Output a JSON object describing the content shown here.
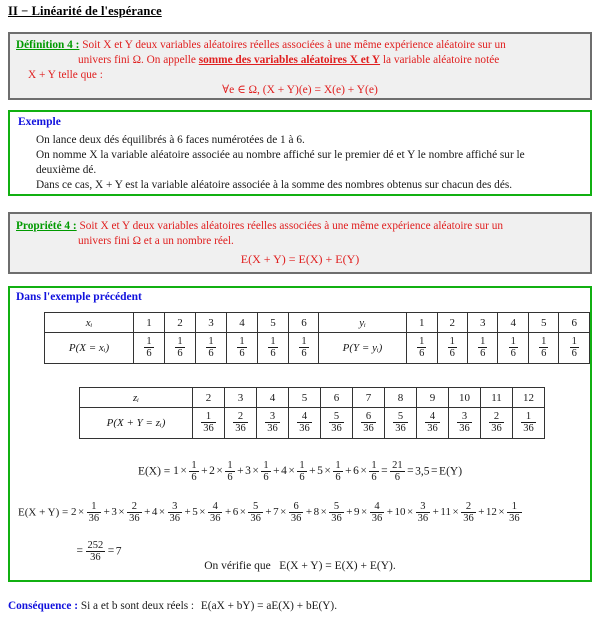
{
  "document": {
    "section_title": "II − Linéarité de l'espérance"
  },
  "definition_box": {
    "label": "Définition 4 :",
    "line1": "Soit X et Y deux variables aléatoires réelles associées à une même expérience aléatoire sur un",
    "line2_before": "univers fini Ω. On appelle ",
    "line2_emph": "somme des variables aléatoires X et Y",
    "line2_after": " la variable aléatoire notée",
    "line3": "X + Y telle que :",
    "formula": "∀e ∈ Ω, (X + Y)(e) = X(e) + Y(e)"
  },
  "example_box": {
    "label": "Exemple",
    "line1": "On lance deux dés équilibrés à 6 faces numérotées de 1 à 6.",
    "line2": "On nomme X la variable aléatoire associée au nombre affiché sur le premier dé et Y le nombre affiché sur le",
    "line3": "deuxième dé.",
    "line4": "Dans ce cas, X + Y est la variable aléatoire associée à la somme des nombres obtenus sur chacun des dés."
  },
  "property_box": {
    "label": "Propriété 4 :",
    "line1": "Soit X et Y deux variables aléatoires réelles associées à une même expérience aléatoire sur un",
    "line2": "univers fini Ω et a un nombre réel.",
    "formula": "E(X + Y) = E(X) + E(Y)"
  },
  "previous_example_box": {
    "label": "Dans l'exemple précédent",
    "verify_prefix": "On vérifie que",
    "verify_formula": "E(X + Y) = E(X) + E(Y)."
  },
  "table_x": {
    "row_header_1": "xᵢ",
    "row_header_2": "P(X = xᵢ)",
    "values": [
      "1",
      "2",
      "3",
      "4",
      "5",
      "6"
    ],
    "probabilities_num": [
      "1",
      "1",
      "1",
      "1",
      "1",
      "1"
    ],
    "probabilities_den": [
      "6",
      "6",
      "6",
      "6",
      "6",
      "6"
    ]
  },
  "table_y": {
    "row_header_1": "yᵢ",
    "row_header_2": "P(Y = yᵢ)",
    "values": [
      "1",
      "2",
      "3",
      "4",
      "5",
      "6"
    ],
    "probabilities_num": [
      "1",
      "1",
      "1",
      "1",
      "1",
      "1"
    ],
    "probabilities_den": [
      "6",
      "6",
      "6",
      "6",
      "6",
      "6"
    ]
  },
  "table_z": {
    "row_header_1": "zᵢ",
    "row_header_2": "P(X + Y = zᵢ)",
    "values": [
      "2",
      "3",
      "4",
      "5",
      "6",
      "7",
      "8",
      "9",
      "10",
      "11",
      "12"
    ],
    "probabilities_num": [
      "1",
      "2",
      "3",
      "4",
      "5",
      "6",
      "5",
      "4",
      "3",
      "2",
      "1"
    ],
    "probabilities_den": [
      "36",
      "36",
      "36",
      "36",
      "36",
      "36",
      "36",
      "36",
      "36",
      "36",
      "36"
    ]
  },
  "computation_ex": {
    "lhs": "E(X) =",
    "terms": [
      {
        "coef": "1",
        "num": "1",
        "den": "6"
      },
      {
        "coef": "2",
        "num": "1",
        "den": "6"
      },
      {
        "coef": "3",
        "num": "1",
        "den": "6"
      },
      {
        "coef": "4",
        "num": "1",
        "den": "6"
      },
      {
        "coef": "5",
        "num": "1",
        "den": "6"
      },
      {
        "coef": "6",
        "num": "1",
        "den": "6"
      }
    ],
    "result_num": "21",
    "result_den": "6",
    "result_decimal": "3,5",
    "tail": "E(Y)"
  },
  "computation_exy": {
    "lhs": "E(X + Y) =",
    "terms": [
      {
        "coef": "2",
        "num": "1",
        "den": "36"
      },
      {
        "coef": "3",
        "num": "2",
        "den": "36"
      },
      {
        "coef": "4",
        "num": "3",
        "den": "36"
      },
      {
        "coef": "5",
        "num": "4",
        "den": "36"
      },
      {
        "coef": "6",
        "num": "5",
        "den": "36"
      },
      {
        "coef": "7",
        "num": "6",
        "den": "36"
      },
      {
        "coef": "8",
        "num": "5",
        "den": "36"
      },
      {
        "coef": "9",
        "num": "4",
        "den": "36"
      },
      {
        "coef": "10",
        "num": "3",
        "den": "36"
      },
      {
        "coef": "11",
        "num": "2",
        "den": "36"
      },
      {
        "coef": "12",
        "num": "1",
        "den": "36"
      }
    ],
    "result_num": "252",
    "result_den": "36",
    "result_value": "7"
  },
  "consequence": {
    "label": "Conséquence :",
    "text": "Si a et b sont deux réels :",
    "formula": "E(aX + bY) = aE(X) + bE(Y)."
  },
  "colors": {
    "green_border": "#11b011",
    "green_label": "#009a00",
    "blue_label": "#1111dd",
    "red_text": "#e02020",
    "gray_border": "#6e6e6e",
    "gray_fill": "#f0f0f0"
  }
}
